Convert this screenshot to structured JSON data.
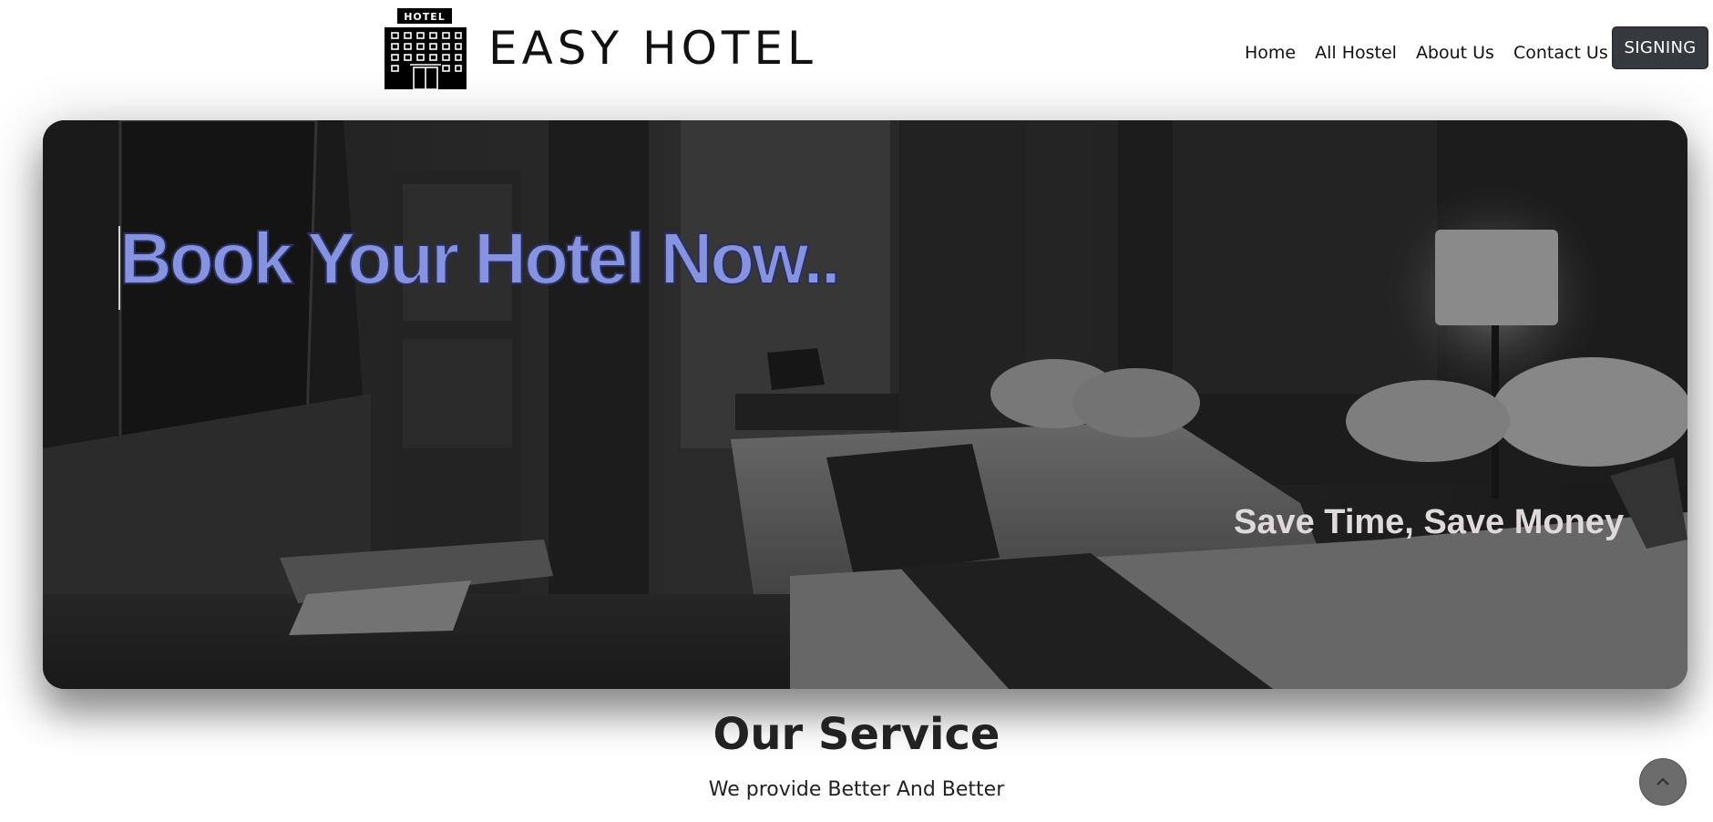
{
  "brand": {
    "logo_sign_text": "HOTEL",
    "name": "EASY HOTEL"
  },
  "nav": {
    "items": [
      {
        "label": "Home"
      },
      {
        "label": "All Hostel"
      },
      {
        "label": "About Us"
      },
      {
        "label": "Contact Us"
      }
    ],
    "signing_label": "SIGNING"
  },
  "hero": {
    "title": "Book Your Hotel Now..",
    "subtitle": "Save Time, Save Money",
    "image": "hotel-room-photo"
  },
  "services": {
    "title": "Our Service",
    "subtitle": "We provide Better And Better"
  },
  "icons": {
    "logo": "hotel-building-icon",
    "scroll_top": "chevron-up-icon"
  },
  "colors": {
    "hero_title": "#8593e0",
    "signing_button": "#343a40",
    "scroll_button": "#6c6c6c"
  }
}
